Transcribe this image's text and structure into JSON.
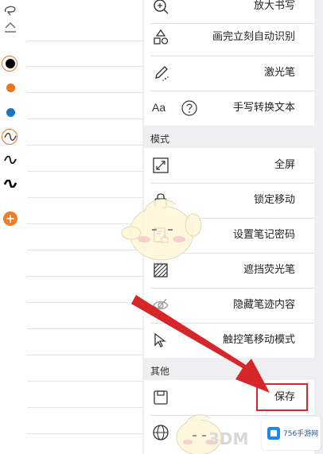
{
  "menu": {
    "items_top": [
      {
        "label": "放大书写",
        "icon": "zoom-in-icon"
      },
      {
        "label": "画完立刻自动识别",
        "icon": "shape-recognize-icon"
      },
      {
        "label": "激光笔",
        "icon": "laser-pen-icon"
      },
      {
        "label": "手写转换文本",
        "icon": "handwriting-to-text-icon",
        "icon_text": "Aa"
      }
    ],
    "section_mode": "模式",
    "items_mode": [
      {
        "label": "全屏",
        "icon": "fullscreen-icon"
      },
      {
        "label": "锁定移动",
        "icon": "lock-icon"
      },
      {
        "label": "设置笔记密码",
        "icon": "note-password-icon"
      },
      {
        "label": "遮挡荧光笔",
        "icon": "highlighter-mask-icon"
      },
      {
        "label": "隐藏笔迹内容",
        "icon": "hide-ink-icon"
      },
      {
        "label": "触控笔移动模式",
        "icon": "stylus-move-icon"
      }
    ],
    "section_other": "其他",
    "items_other": [
      {
        "label": "保存",
        "icon": "save-icon"
      },
      {
        "label": "",
        "icon": "globe-icon"
      }
    ]
  },
  "tools": {
    "colors": [
      "#000000",
      "#e8741e",
      "#1e73be"
    ],
    "add_symbol": "+"
  },
  "watermark": {
    "text_3dm": "3DM",
    "badge_text": "756手游网"
  },
  "accent": "#d7262a"
}
